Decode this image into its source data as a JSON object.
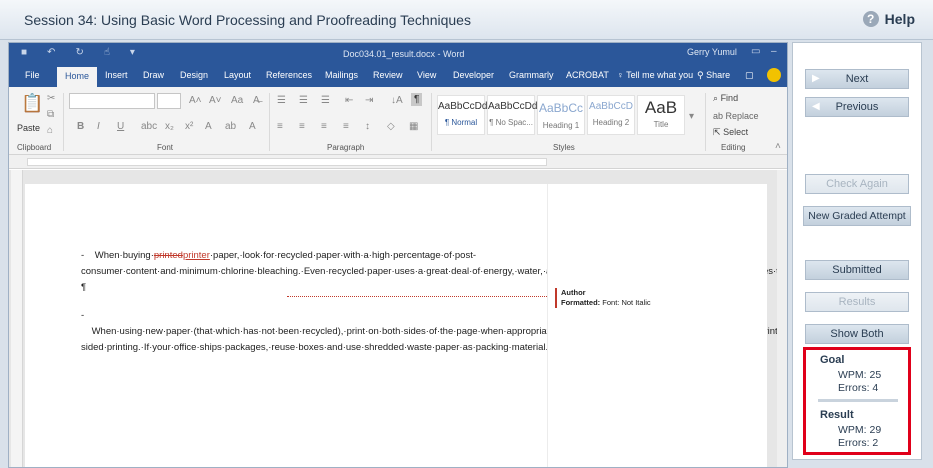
{
  "session": {
    "title": "Session 34: Using Basic Word Processing and Proofreading Techniques",
    "help": "Help"
  },
  "word": {
    "doc_name": "Doc034.01_result.docx  -  Word",
    "user": "Gerry Yumul",
    "tabs": [
      "File",
      "Home",
      "Insert",
      "Draw",
      "Design",
      "Layout",
      "References",
      "Mailings",
      "Review",
      "View",
      "Developer",
      "Grammarly",
      "ACROBAT"
    ],
    "tell_me": "Tell me what you",
    "share": "Share",
    "ribbon": {
      "clipboard": "Clipboard",
      "paste": "Paste",
      "font": "Font",
      "paragraph": "Paragraph",
      "styles": "Styles",
      "editing": "Editing",
      "find": "Find",
      "replace": "Replace",
      "select": "Select",
      "style_items": [
        {
          "sample": "AaBbCcDd",
          "name": "¶ Normal"
        },
        {
          "sample": "AaBbCcDd",
          "name": "¶ No Spac..."
        },
        {
          "sample": "AaBbCc",
          "name": "Heading 1"
        },
        {
          "sample": "AaBbCcD",
          "name": "Heading 2"
        },
        {
          "sample": "AaB",
          "name": "Title"
        }
      ]
    },
    "doc": {
      "p1_bullet": "-",
      "p1_start": "When·buying·",
      "p1_deleted": "printed",
      "p1_inserted": "printer",
      "p1_rest": "·paper,·look·for·recycled·paper·with·a·high·percentage·of·post-consumer·content·and·minimum·chlorine·bleaching.·Even·recycled·paper·uses·a·great·deal·of·energy,·water,·and·chemical·resources·in·its·processing·and·creates·toxic·pulp·as·a·result.·You·can·help·save·the·planet!¶",
      "p2_bullet": "-",
      "p2_text": "When·using·new·paper·(that·which·has·not·been·recycled),·print·on·both·sides·of·the·page·when·appropriate·and·use·misprints·as·notepaper.·Try·to·choose·printers·and·photocopiers·that·do·double-sided·printing.·If·your·office·ships·packages,·reuse·boxes·and·use·shredded·waste·paper·as·packing·material.¶",
      "comment_author": "Author",
      "comment_label": "Formatted:",
      "comment_text": "Font: Not Italic"
    }
  },
  "nav": {
    "next": "Next",
    "previous": "Previous",
    "check_again": "Check Again",
    "new_attempt": "New Graded Attempt",
    "submitted": "Submitted",
    "results": "Results",
    "show_both": "Show Both"
  },
  "stats": {
    "goal_title": "Goal",
    "goal_wpm": "WPM:  25",
    "goal_errors": "Errors:  4",
    "result_title": "Result",
    "result_wpm": "WPM:  29",
    "result_errors": "Errors:  2"
  }
}
